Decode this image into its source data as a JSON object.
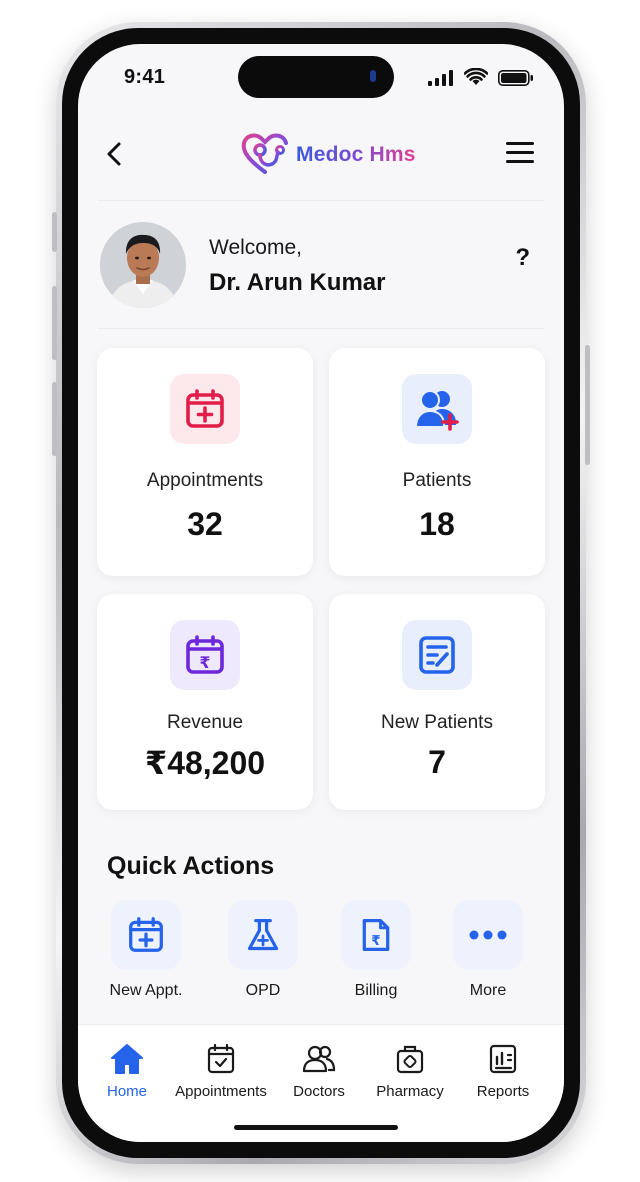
{
  "status_bar": {
    "time": "9:41"
  },
  "header": {
    "app_name": "Medoc Hms"
  },
  "profile": {
    "greeting": "Welcome,",
    "name": "Dr. Arun Kumar",
    "help": "?"
  },
  "stats": [
    {
      "label": "Appointments",
      "value": "32",
      "icon": "calendar-plus-icon",
      "accent": "#e11d48"
    },
    {
      "label": "Patients",
      "value": "18",
      "icon": "patients-icon",
      "accent": "#2563eb"
    },
    {
      "label": "Revenue",
      "value": "₹48,200",
      "icon": "calendar-rupee-icon",
      "accent": "#6d28d9"
    },
    {
      "label": "New Patients",
      "value": "7",
      "icon": "form-icon",
      "accent": "#2563eb"
    }
  ],
  "quick_actions": {
    "title": "Quick Actions",
    "items": [
      {
        "label": "New Appt.",
        "icon": "calendar-plus-icon"
      },
      {
        "label": "OPD",
        "icon": "flask-icon"
      },
      {
        "label": "Billing",
        "icon": "bill-icon"
      },
      {
        "label": "More",
        "icon": "more-icon"
      }
    ]
  },
  "bottom_nav": {
    "items": [
      {
        "label": "Home",
        "icon": "home-icon",
        "active": true
      },
      {
        "label": "Appointments",
        "icon": "calendar-check-icon",
        "active": false
      },
      {
        "label": "Doctors",
        "icon": "doctors-icon",
        "active": false
      },
      {
        "label": "Pharmacy",
        "icon": "medkit-icon",
        "active": false
      },
      {
        "label": "Reports",
        "icon": "reports-icon",
        "active": false
      }
    ]
  },
  "colors": {
    "primary": "#2563eb",
    "danger": "#e11d48",
    "purple": "#6d28d9",
    "background": "#f7f7f9"
  }
}
